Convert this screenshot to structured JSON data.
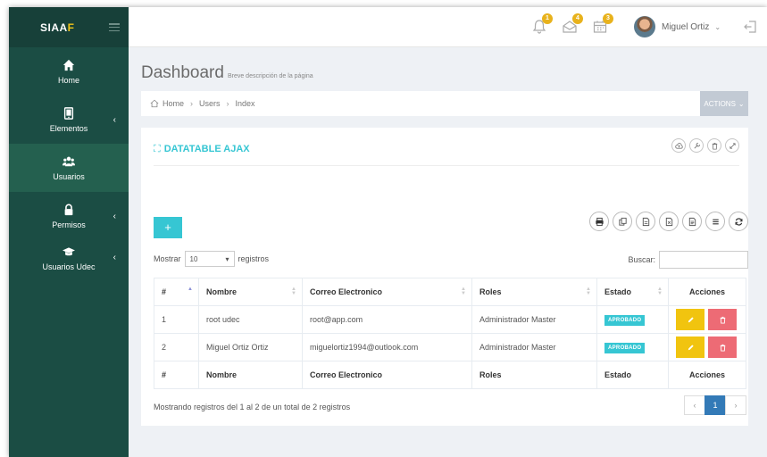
{
  "app": {
    "brand_prefix": "SIAA",
    "brand_suffix": "F"
  },
  "sidebar": {
    "items": [
      {
        "label": "Home",
        "icon": "home-icon"
      },
      {
        "label": "Elementos",
        "icon": "tablet-icon"
      },
      {
        "label": "Usuarios",
        "icon": "users-icon"
      },
      {
        "label": "Permisos",
        "icon": "lock-icon"
      },
      {
        "label": "Usuarios Udec",
        "icon": "graduation-cap-icon"
      }
    ]
  },
  "topbar": {
    "notifications": [
      {
        "icon": "bell-icon",
        "count": "1"
      },
      {
        "icon": "envelope-icon",
        "count": "4"
      },
      {
        "icon": "calendar-icon",
        "count": "3"
      }
    ],
    "user_name": "Miguel Ortiz"
  },
  "page": {
    "title": "Dashboard",
    "subtitle": "Breve descripción de la página"
  },
  "breadcrumb": [
    "Home",
    "Users",
    "Index"
  ],
  "actions_label": "ACTIONS",
  "portlet": {
    "title": "DATATABLE AJAX"
  },
  "table": {
    "length_label_before": "Mostrar",
    "length_value": "10",
    "length_label_after": "registros",
    "search_label": "Buscar:",
    "columns": [
      "#",
      "Nombre",
      "Correo Electronico",
      "Roles",
      "Estado",
      "Acciones"
    ],
    "rows": [
      {
        "id": "1",
        "name": "root udec",
        "email": "root@app.com",
        "role": "Administrador Master",
        "status": "APROBADO"
      },
      {
        "id": "2",
        "name": "Miguel Ortiz Ortiz",
        "email": "miguelortiz1994@outlook.com",
        "role": "Administrador Master",
        "status": "APROBADO"
      }
    ],
    "info": "Mostrando registros del 1 al 2 de un total de 2 registros",
    "pagination": {
      "prev": "‹",
      "current": "1",
      "next": "›"
    }
  },
  "colors": {
    "sidebar": "#1b4d44",
    "accent": "#36c6d3",
    "edit": "#f1c40f",
    "delete": "#ed6b75",
    "badge": "#e8b21c"
  }
}
